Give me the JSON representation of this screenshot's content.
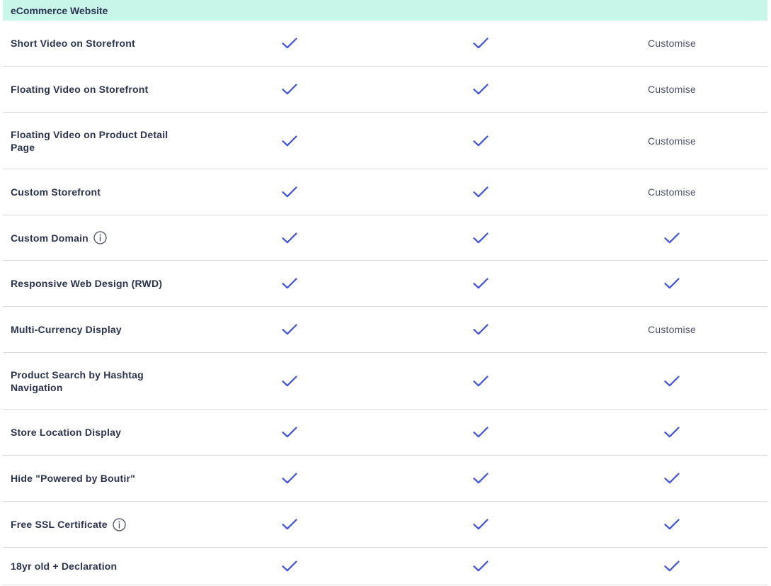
{
  "section": {
    "title": "eCommerce Website"
  },
  "rows": [
    {
      "feature": "Short Video on Storefront",
      "info": false,
      "values": [
        "check",
        "check",
        "Customise"
      ]
    },
    {
      "feature": "Floating Video on Storefront",
      "info": false,
      "values": [
        "check",
        "check",
        "Customise"
      ]
    },
    {
      "feature": "Floating Video on Product Detail Page",
      "info": false,
      "values": [
        "check",
        "check",
        "Customise"
      ]
    },
    {
      "feature": "Custom Storefront",
      "info": false,
      "values": [
        "check",
        "check",
        "Customise"
      ]
    },
    {
      "feature": "Custom Domain",
      "info": true,
      "values": [
        "check",
        "check",
        "check"
      ]
    },
    {
      "feature": "Responsive Web Design (RWD)",
      "info": false,
      "values": [
        "check",
        "check",
        "check"
      ]
    },
    {
      "feature": "Multi-Currency Display",
      "info": false,
      "values": [
        "check",
        "check",
        "Customise"
      ]
    },
    {
      "feature": "Product Search by Hashtag Navigation",
      "info": false,
      "values": [
        "check",
        "check",
        "check"
      ]
    },
    {
      "feature": "Store Location Display",
      "info": false,
      "values": [
        "check",
        "check",
        "check"
      ]
    },
    {
      "feature": "Hide \"Powered by Boutir\"",
      "info": false,
      "values": [
        "check",
        "check",
        "check"
      ]
    },
    {
      "feature": "Free SSL Certificate",
      "info": true,
      "values": [
        "check",
        "check",
        "check"
      ]
    },
    {
      "feature": "18yr old + Declaration",
      "info": false,
      "values": [
        "check",
        "check",
        "check"
      ]
    }
  ],
  "icons": {
    "check": "checkmark-icon",
    "info": "info-icon"
  },
  "colors": {
    "header_bg": "#c8f7ea",
    "check": "#3f51e8",
    "text": "#2a3350",
    "muted": "#4a5065",
    "divider": "#d9d9d9"
  }
}
